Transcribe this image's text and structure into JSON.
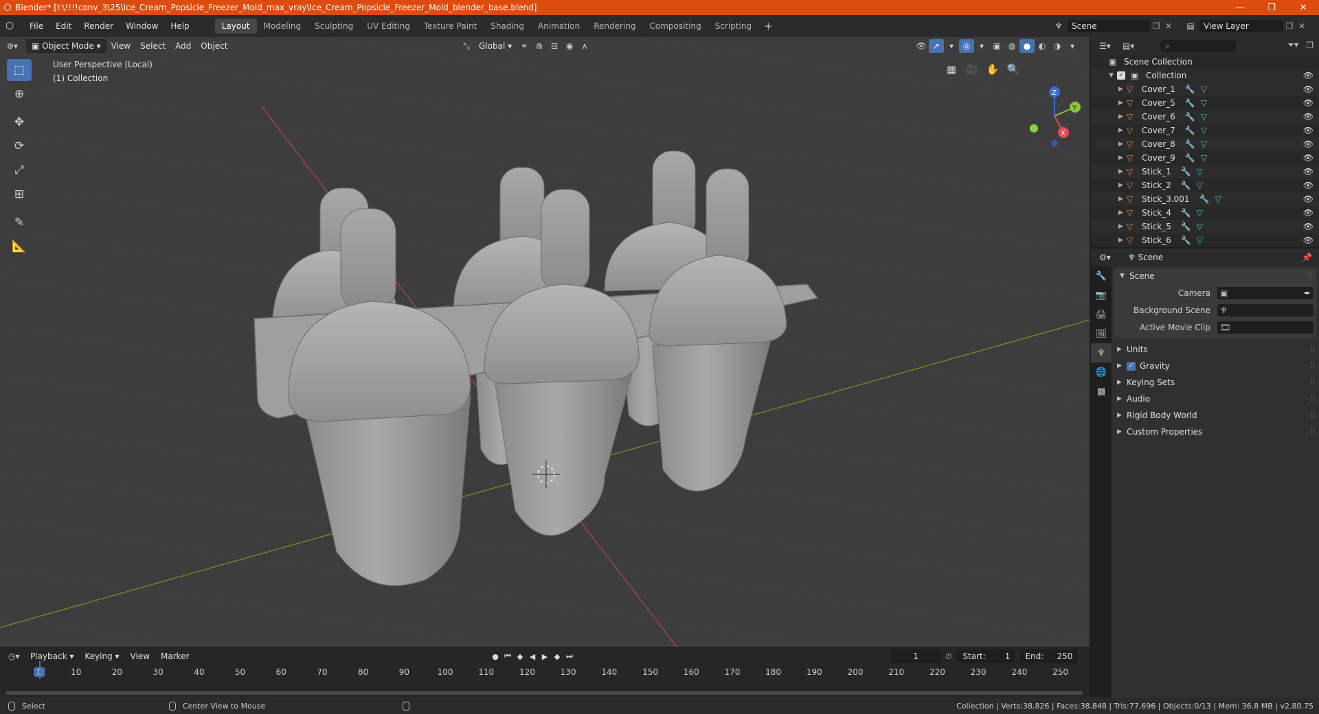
{
  "titlebar": {
    "title": "Blender* [I:\\!!!!conv_3\\25\\Ice_Cream_Popsicle_Freezer_Mold_max_vray\\Ice_Cream_Popsicle_Freezer_Mold_blender_base.blend]",
    "minimize": "—",
    "maximize": "❐",
    "close": "✕"
  },
  "menu": [
    "File",
    "Edit",
    "Render",
    "Window",
    "Help"
  ],
  "workspaces": [
    "Layout",
    "Modeling",
    "Sculpting",
    "UV Editing",
    "Texture Paint",
    "Shading",
    "Animation",
    "Rendering",
    "Compositing",
    "Scripting"
  ],
  "workspace_add": "+",
  "scene_selector": {
    "value": "Scene"
  },
  "view_layer_selector": {
    "value": "View Layer"
  },
  "viewport": {
    "mode": "Object Mode",
    "menus": [
      "View",
      "Select",
      "Add",
      "Object"
    ],
    "transform_orientation": "Global",
    "overlay_title": "User Perspective (Local)",
    "overlay_collection": "(1) Collection",
    "axis_labels": {
      "x": "X",
      "y": "Y",
      "z": "Z"
    }
  },
  "outliner": {
    "root": "Scene Collection",
    "collection": "Collection",
    "items": [
      "Cover_1",
      "Cover_5",
      "Cover_6",
      "Cover_7",
      "Cover_8",
      "Cover_9",
      "Stick_1",
      "Stick_2",
      "Stick_3.001",
      "Stick_4",
      "Stick_5",
      "Stick_6"
    ]
  },
  "properties": {
    "header_title": "Scene",
    "scene_panel": "Scene",
    "camera_label": "Camera",
    "background_scene_label": "Background Scene",
    "active_movie_clip_label": "Active Movie Clip",
    "panels": [
      "Units",
      "Gravity",
      "Keying Sets",
      "Audio",
      "Rigid Body World",
      "Custom Properties"
    ]
  },
  "timeline": {
    "menus": [
      "Playback",
      "Keying",
      "View",
      "Marker"
    ],
    "current_frame": "1",
    "start_label": "Start:",
    "start_value": "1",
    "end_label": "End:",
    "end_value": "250",
    "ruler": [
      "1",
      "10",
      "20",
      "30",
      "40",
      "50",
      "60",
      "70",
      "80",
      "90",
      "100",
      "110",
      "120",
      "130",
      "140",
      "150",
      "160",
      "170",
      "180",
      "190",
      "200",
      "210",
      "220",
      "230",
      "240",
      "250"
    ]
  },
  "statusbar": {
    "select": "Select",
    "center_view": "Center View to Mouse",
    "stats": "Collection | Verts:38,826 | Faces:38,848 | Tris:77,696 | Objects:0/13 | Mem: 36.8 MB | v2.80.75"
  },
  "colors": {
    "title_bar": "#de4b0e",
    "accent": "#4772b3",
    "viewport_bg": "#3d3d3d",
    "object_icon": "#e98f3d",
    "mesh_icon": "#48c9a9"
  }
}
